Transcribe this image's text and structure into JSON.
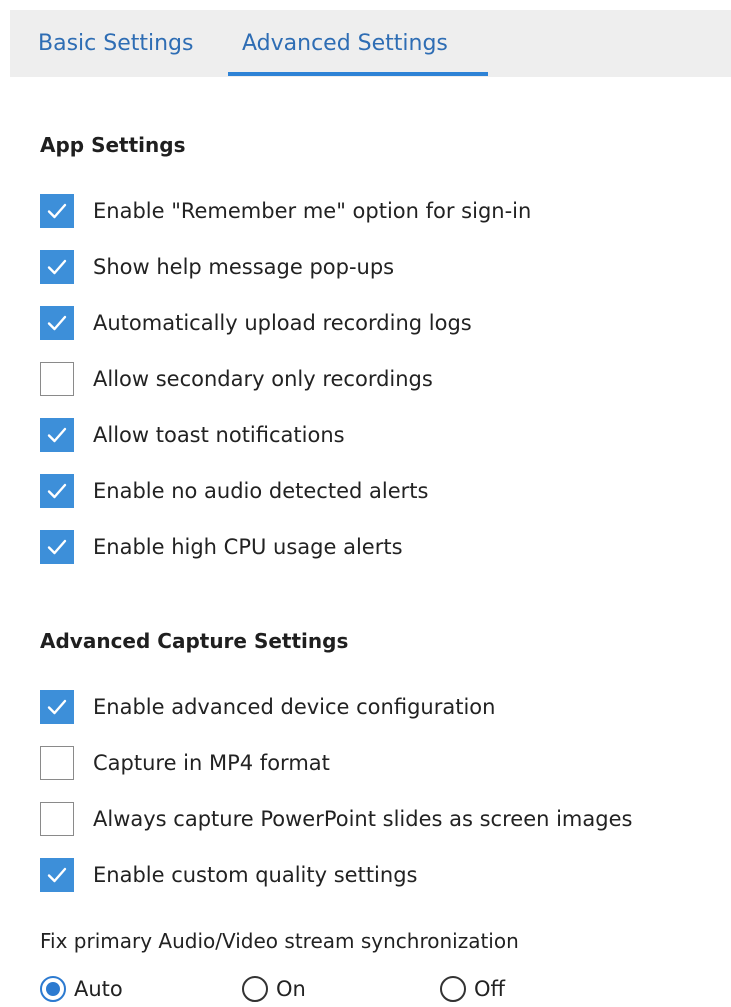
{
  "tabs": {
    "basic": "Basic Settings",
    "advanced": "Advanced Settings",
    "active": "advanced"
  },
  "app_settings": {
    "title": "App Settings",
    "items": [
      {
        "label": "Enable \"Remember me\" option for sign-in",
        "checked": true
      },
      {
        "label": "Show help message pop-ups",
        "checked": true
      },
      {
        "label": "Automatically upload recording logs",
        "checked": true
      },
      {
        "label": "Allow secondary only recordings",
        "checked": false
      },
      {
        "label": "Allow toast notifications",
        "checked": true
      },
      {
        "label": "Enable no audio detected alerts",
        "checked": true
      },
      {
        "label": "Enable high CPU usage alerts",
        "checked": true
      }
    ]
  },
  "capture_settings": {
    "title": "Advanced Capture Settings",
    "items": [
      {
        "label": "Enable advanced device configuration",
        "checked": true
      },
      {
        "label": "Capture in MP4 format",
        "checked": false
      },
      {
        "label": "Always capture PowerPoint slides as screen images",
        "checked": false
      },
      {
        "label": "Enable custom quality settings",
        "checked": true
      }
    ]
  },
  "sync": {
    "label": "Fix primary Audio/Video stream synchronization",
    "options": [
      {
        "label": "Auto",
        "selected": true
      },
      {
        "label": "On",
        "selected": false
      },
      {
        "label": "Off",
        "selected": false
      }
    ]
  },
  "colors": {
    "accent": "#3d8fd9",
    "tab_text": "#2e6db4",
    "tab_bar_bg": "#eeeeee"
  }
}
